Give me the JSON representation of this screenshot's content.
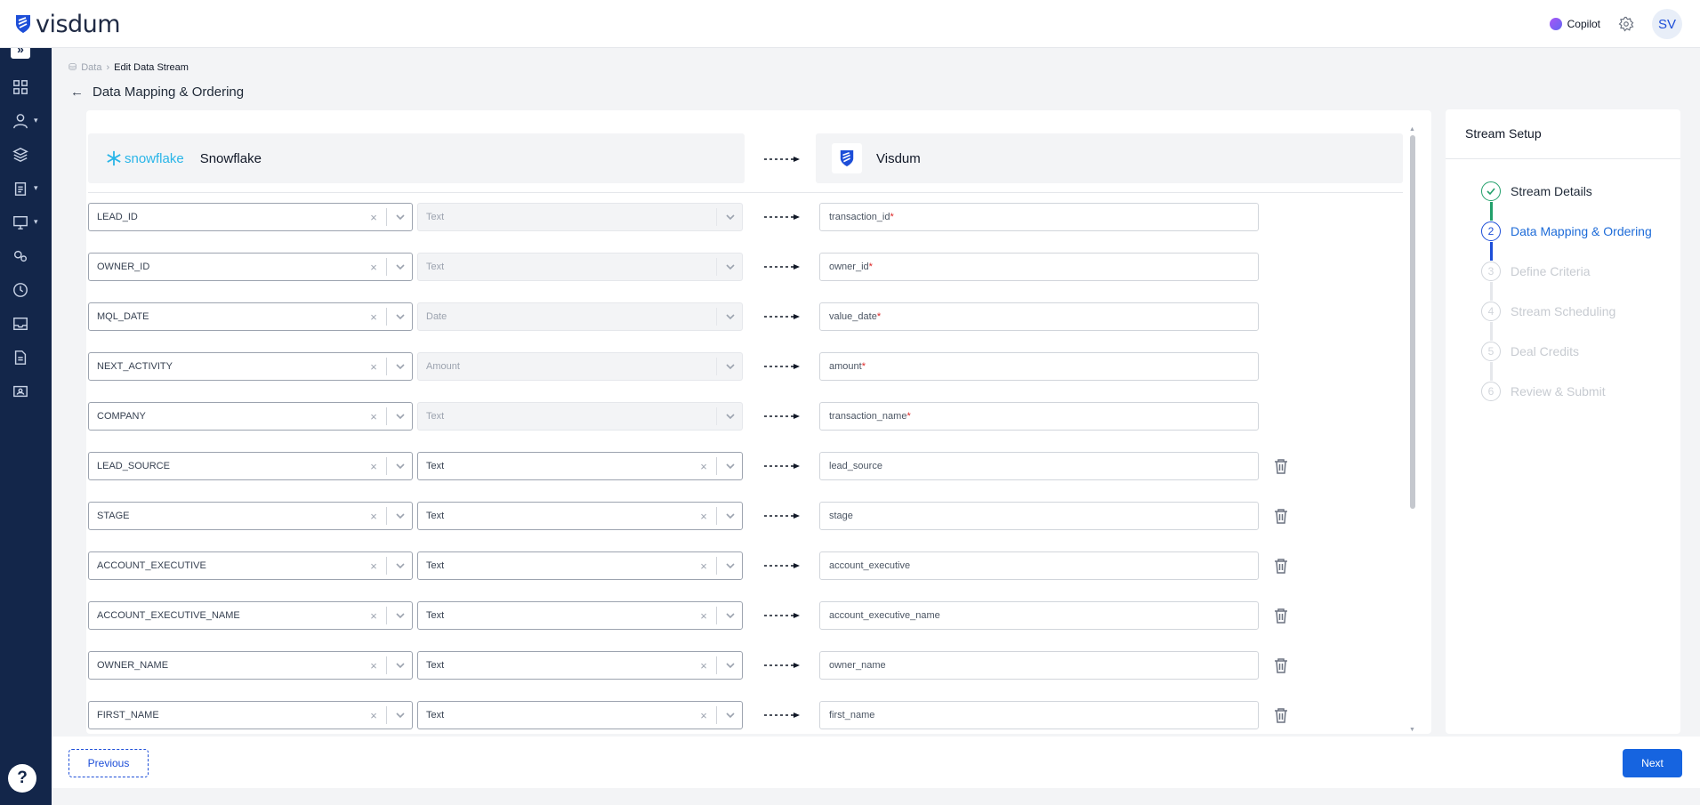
{
  "app": {
    "logo_text": "visdum"
  },
  "header": {
    "copilot_label": "Copilot",
    "avatar_initials": "SV"
  },
  "breadcrumb": {
    "root": "Data",
    "current": "Edit Data Stream"
  },
  "page": {
    "title": "Data Mapping & Ordering"
  },
  "mapping": {
    "source_logo_text": "snowflake",
    "source_name": "Snowflake",
    "destination_name": "Visdum",
    "rows": [
      {
        "source": "LEAD_ID",
        "type": "Text",
        "target": "transaction_id",
        "required": "*",
        "locked": true
      },
      {
        "source": "OWNER_ID",
        "type": "Text",
        "target": "owner_id",
        "required": "*",
        "locked": true
      },
      {
        "source": "MQL_DATE",
        "type": "Date",
        "target": "value_date",
        "required": "*",
        "locked": true
      },
      {
        "source": "NEXT_ACTIVITY",
        "type": "Amount",
        "target": "amount",
        "required": "*",
        "locked": true
      },
      {
        "source": "COMPANY",
        "type": "Text",
        "target": "transaction_name",
        "required": "*",
        "locked": true
      },
      {
        "source": "LEAD_SOURCE",
        "type": "Text",
        "target": "lead_source",
        "required": "",
        "locked": false
      },
      {
        "source": "STAGE",
        "type": "Text",
        "target": "stage",
        "required": "",
        "locked": false
      },
      {
        "source": "ACCOUNT_EXECUTIVE",
        "type": "Text",
        "target": "account_executive",
        "required": "",
        "locked": false
      },
      {
        "source": "ACCOUNT_EXECUTIVE_NAME",
        "type": "Text",
        "target": "account_executive_name",
        "required": "",
        "locked": false
      },
      {
        "source": "OWNER_NAME",
        "type": "Text",
        "target": "owner_name",
        "required": "",
        "locked": false
      },
      {
        "source": "FIRST_NAME",
        "type": "Text",
        "target": "first_name",
        "required": "",
        "locked": false
      }
    ]
  },
  "setup": {
    "title": "Stream Setup",
    "steps": [
      {
        "number": "1",
        "label": "Stream Details",
        "state": "done"
      },
      {
        "number": "2",
        "label": "Data Mapping & Ordering",
        "state": "active"
      },
      {
        "number": "3",
        "label": "Define Criteria",
        "state": "pending"
      },
      {
        "number": "4",
        "label": "Stream Scheduling",
        "state": "pending"
      },
      {
        "number": "5",
        "label": "Deal Credits",
        "state": "pending"
      },
      {
        "number": "6",
        "label": "Review & Submit",
        "state": "pending"
      }
    ]
  },
  "footer": {
    "previous_label": "Previous",
    "next_label": "Next"
  },
  "help": {
    "label": "?"
  },
  "colors": {
    "sidebar": "#13264a",
    "accent": "#1664e0",
    "done": "#22a06b",
    "required": "#dc2626"
  },
  "icons": [
    "visdum-logo-icon",
    "copilot-icon",
    "gear-icon",
    "expand-icon",
    "dashboard-icon",
    "user-icon",
    "layers-icon",
    "clipboard-icon",
    "monitor-icon",
    "gears-icon",
    "clock-icon",
    "inbox-icon",
    "document-icon",
    "id-card-icon",
    "snowflake-icon",
    "back-arrow-icon",
    "chevron-down-icon",
    "clear-icon",
    "dashed-arrow-icon",
    "trash-icon",
    "check-icon"
  ]
}
